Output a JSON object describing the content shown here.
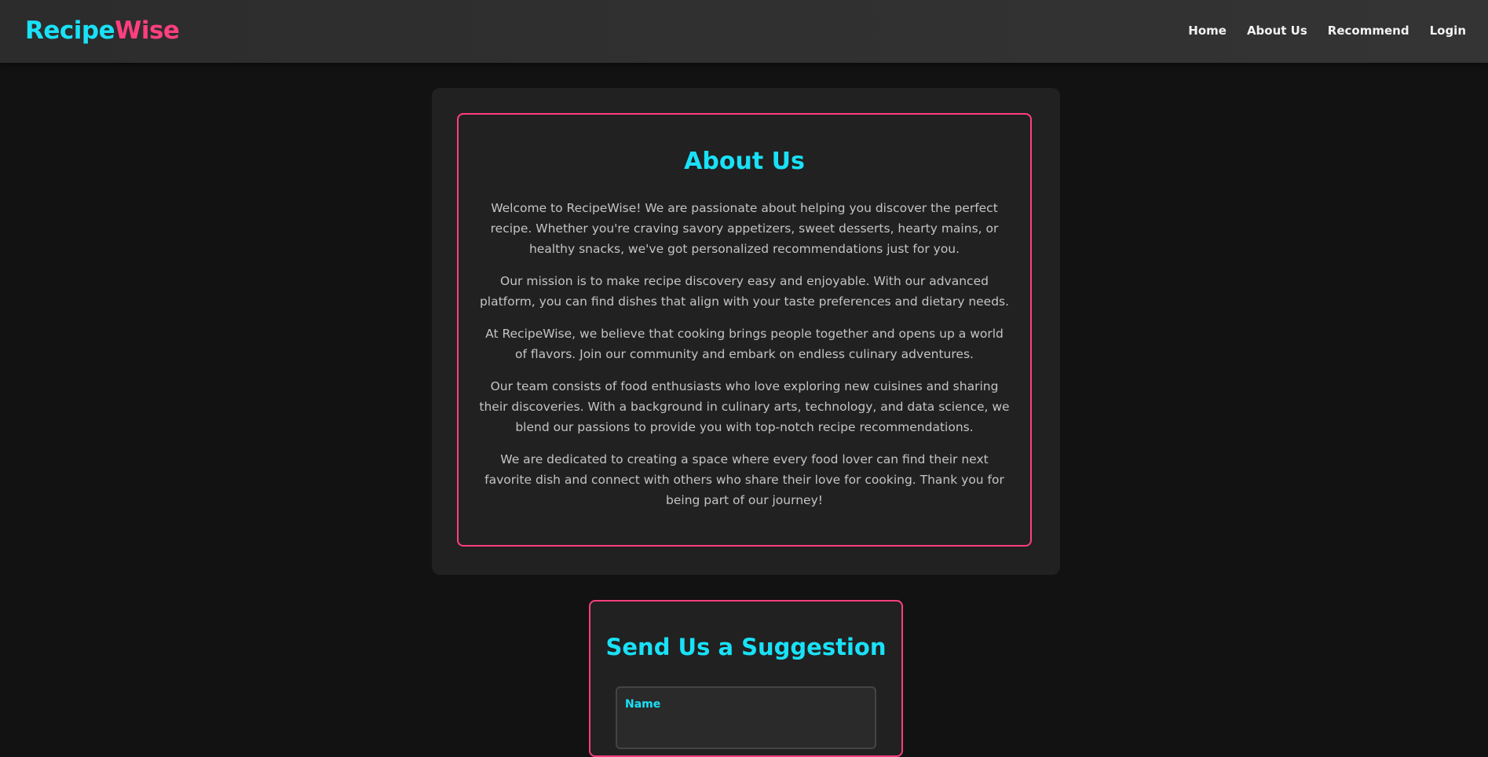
{
  "navbar": {
    "logo_part1": "Recipe",
    "logo_part2": "Wise",
    "links": [
      "Home",
      "About Us",
      "Recommend",
      "Login"
    ]
  },
  "about": {
    "title": "About Us",
    "paragraphs": [
      "Welcome to RecipeWise! We are passionate about helping you discover the perfect recipe. Whether you're craving savory appetizers, sweet desserts, hearty mains, or healthy snacks, we've got personalized recommendations just for you.",
      "Our mission is to make recipe discovery easy and enjoyable. With our advanced platform, you can find dishes that align with your taste preferences and dietary needs.",
      "At RecipeWise, we believe that cooking brings people together and opens up a world of flavors. Join our community and embark on endless culinary adventures.",
      "Our team consists of food enthusiasts who love exploring new cuisines and sharing their discoveries. With a background in culinary arts, technology, and data science, we blend our passions to provide you with top-notch recipe recommendations.",
      "We are dedicated to creating a space where every food lover can find their next favorite dish and connect with others who share their love for cooking. Thank you for being part of our journey!"
    ]
  },
  "suggestion": {
    "title": "Send Us a Suggestion",
    "name_label": "Name"
  },
  "colors": {
    "accent_cyan": "#19e1f7",
    "accent_pink": "#ff3f7f",
    "background": "#121212",
    "card": "#212121"
  }
}
